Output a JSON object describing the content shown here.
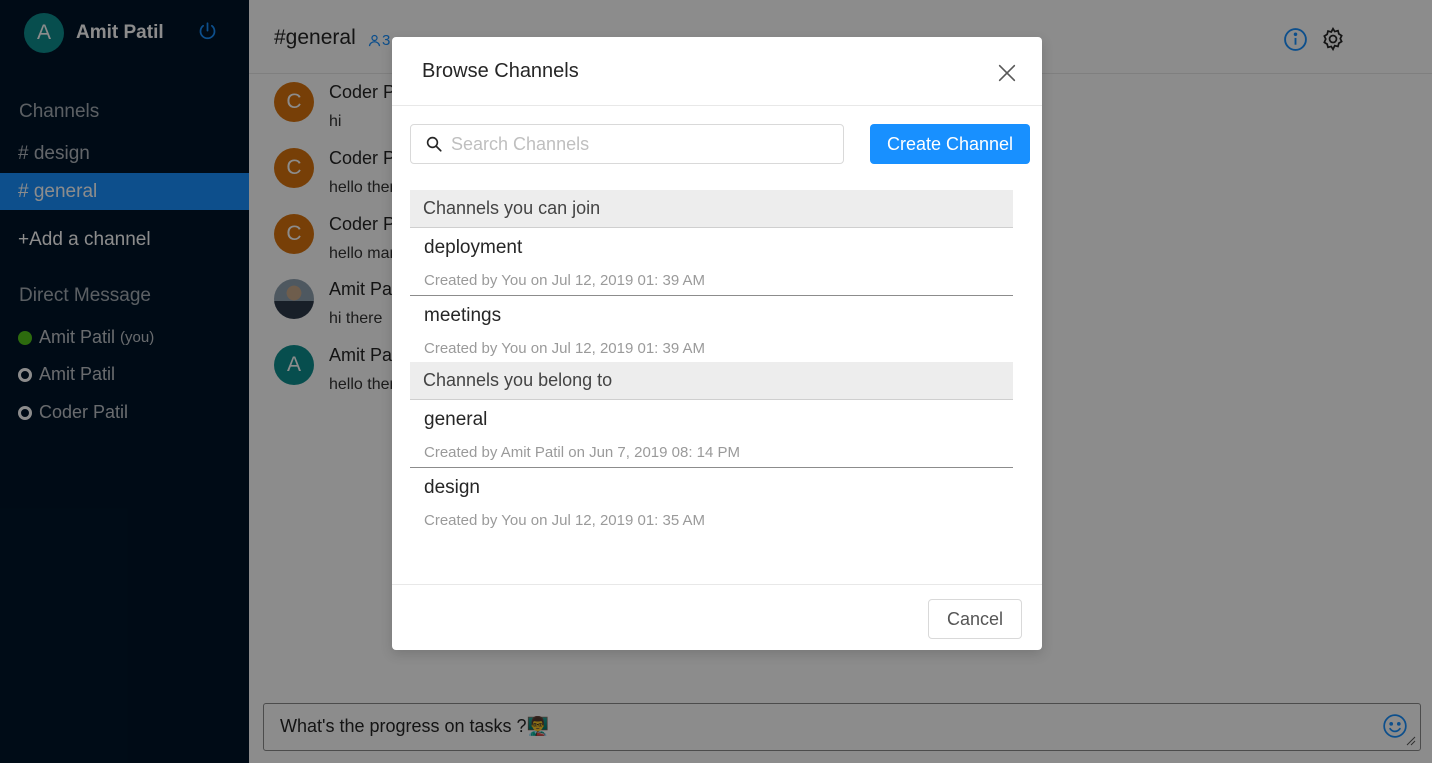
{
  "user": {
    "avatar_letter": "A",
    "name": "Amit Patil"
  },
  "sidebar": {
    "channels_title": "Channels",
    "channels": [
      {
        "label": "# design",
        "active": false
      },
      {
        "label": "# general",
        "active": true
      }
    ],
    "add_channel_label": "+Add a channel",
    "dm_title": "Direct Message",
    "direct_messages": [
      {
        "name": "Amit Patil",
        "tag": "(you)",
        "status": "online"
      },
      {
        "name": "Amit Patil",
        "tag": "",
        "status": "offline"
      },
      {
        "name": "Coder Patil",
        "tag": "",
        "status": "offline"
      }
    ]
  },
  "header": {
    "channel_title": "#general",
    "member_count": "3"
  },
  "messages": [
    {
      "avatar_letter": "C",
      "author": "Coder Patil",
      "body": "hi"
    },
    {
      "avatar_letter": "C",
      "author": "Coder Patil",
      "body": "hello there"
    },
    {
      "avatar_letter": "C",
      "author": "Coder Patil",
      "body": "hello man"
    },
    {
      "avatar_letter": "",
      "author": "Amit Patil",
      "body": "hi there"
    },
    {
      "avatar_letter": "A",
      "author": "Amit Patil",
      "body": "hello there"
    }
  ],
  "composer": {
    "text": "What's the progress on tasks ?👨‍🏫"
  },
  "modal": {
    "title": "Browse Channels",
    "search_placeholder": "Search Channels",
    "create_button": "Create Channel",
    "groups": [
      {
        "title": "Channels you can join",
        "items": [
          {
            "name": "deployment",
            "meta": "Created by You on Jul 12, 2019 01: 39 AM"
          },
          {
            "name": "meetings",
            "meta": "Created by You on Jul 12, 2019 01: 39 AM"
          }
        ]
      },
      {
        "title": "Channels you belong to",
        "items": [
          {
            "name": "general",
            "meta": "Created by Amit Patil on Jun 7, 2019 08: 14 PM"
          },
          {
            "name": "design",
            "meta": "Created by You on Jul 12, 2019 01: 35 AM"
          }
        ]
      }
    ],
    "cancel_button": "Cancel"
  },
  "colors": {
    "sidebar_bg": "#001529",
    "accent": "#1890ff",
    "online": "#52c41a"
  }
}
